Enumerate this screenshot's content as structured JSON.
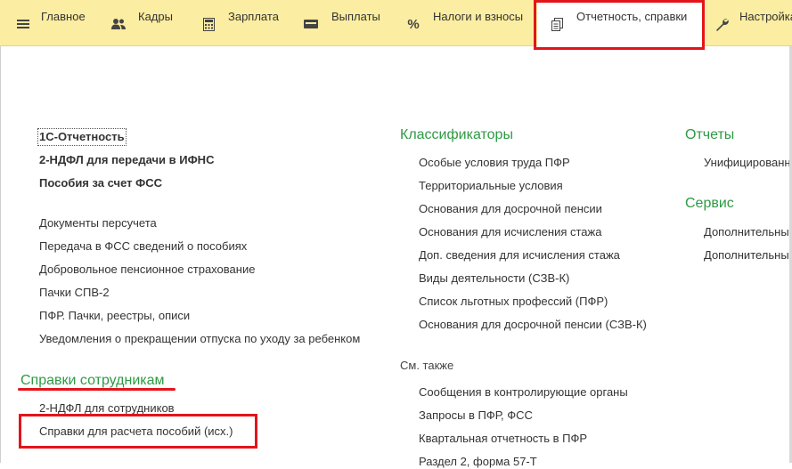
{
  "menu": {
    "items": [
      {
        "label": "Главное",
        "icon": "hamburger-menu-icon"
      },
      {
        "label": "Кадры",
        "icon": "people-icon"
      },
      {
        "label": "Зарплата",
        "icon": "calculator-icon"
      },
      {
        "label": "Выплаты",
        "icon": "wallet-icon"
      },
      {
        "label": "Налоги и взносы",
        "icon": "percent-icon"
      },
      {
        "label": "Отчетность, справки",
        "icon": "documents-icon"
      },
      {
        "label": "Настройка",
        "icon": "wrench-icon"
      }
    ]
  },
  "left": {
    "top_links": [
      "1С-Отчетность",
      "2-НДФЛ для передачи в ИФНС",
      "Пособия за счет ФСС"
    ],
    "links": [
      "Документы персучета",
      "Передача в ФСС сведений о пособиях",
      "Добровольное пенсионное страхование",
      "Пачки СПВ-2",
      "ПФР. Пачки, реестры, описи",
      "Уведомления о прекращении отпуска по уходу за ребенком"
    ],
    "section_title": "Справки сотрудникам",
    "section_links": [
      "2-НДФЛ для сотрудников",
      "Справки для расчета пособий (исх.)"
    ]
  },
  "middle": {
    "title": "Классификаторы",
    "links": [
      "Особые условия труда ПФР",
      "Территориальные условия",
      "Основания для досрочной пенсии",
      "Основания для исчисления стажа",
      "Доп. сведения для исчисления стажа",
      "Виды деятельности (СЗВ-К)",
      "Список льготных профессий (ПФР)",
      "Основания для досрочной пенсии (СЗВ-К)"
    ],
    "see_also_title": "См. также",
    "see_also_links": [
      "Сообщения в контролирующие органы",
      "Запросы в ПФР, ФСС",
      "Квартальная отчетность в ПФР",
      "Раздел 2, форма 57-Т"
    ]
  },
  "right": {
    "reports_title": "Отчеты",
    "reports_links": [
      "Унифицированные"
    ],
    "service_title": "Сервис",
    "service_links": [
      "Дополнительные",
      "Дополнительные"
    ]
  },
  "colors": {
    "menu_bg": "#fbeda1",
    "section_green": "#2e9a44",
    "highlight_red": "#e3141b"
  }
}
